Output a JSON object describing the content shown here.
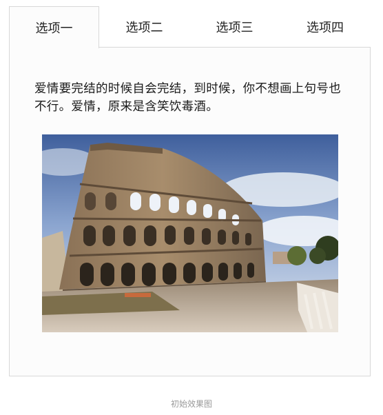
{
  "tabs": [
    {
      "label": "选项一",
      "active": true
    },
    {
      "label": "选项二",
      "active": false
    },
    {
      "label": "选项三",
      "active": false
    },
    {
      "label": "选项四",
      "active": false
    }
  ],
  "panel": {
    "text": "爱情要完结的时候自会完结，到时候，你不想画上句号也不行。爱情，原来是含笑饮毒酒。",
    "image": {
      "subject": "colosseum-photo"
    }
  },
  "caption": "初始效果图",
  "colors": {
    "tab_border": "#d8d8d8",
    "panel_background": "#fcfcfc",
    "caption_text": "#9a9a9a"
  }
}
